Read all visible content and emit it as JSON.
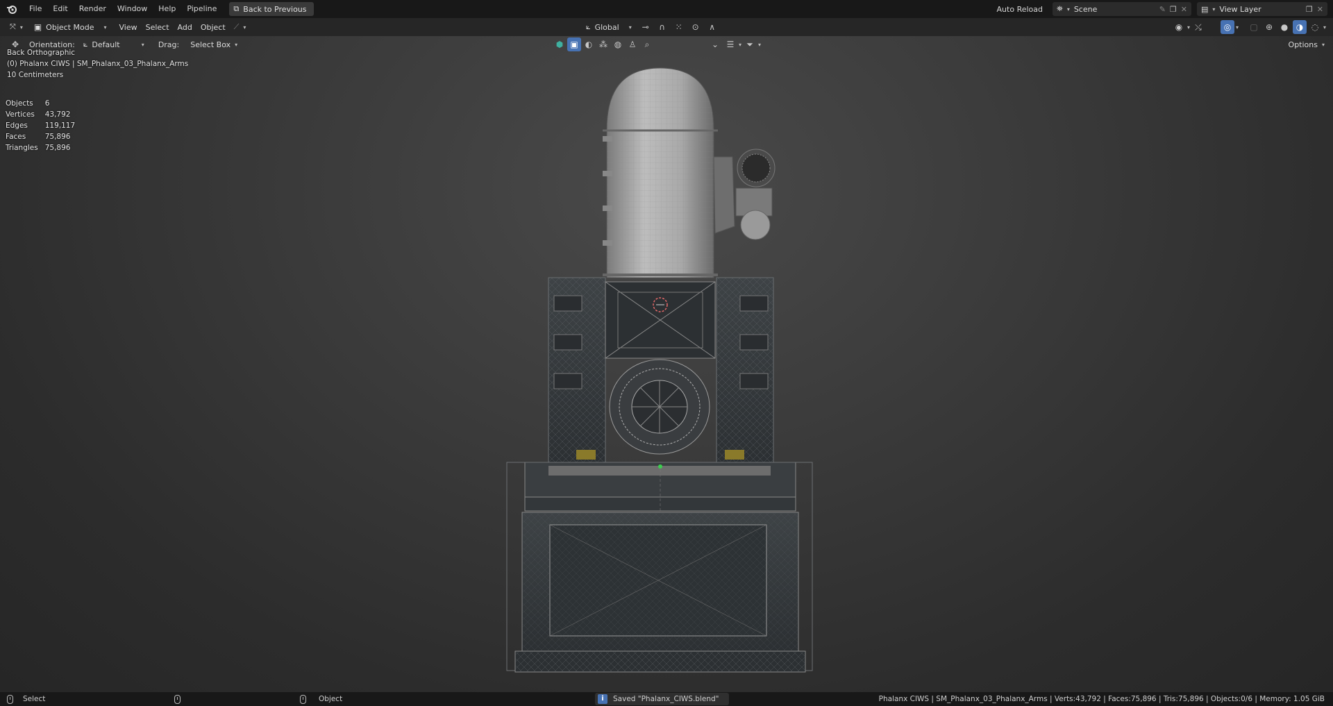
{
  "menu": {
    "items": [
      "File",
      "Edit",
      "Render",
      "Window",
      "Help",
      "Pipeline"
    ],
    "back_button": "Back to Previous"
  },
  "topright": {
    "auto_reload": "Auto Reload",
    "scene": "Scene",
    "view_layer": "View Layer"
  },
  "header": {
    "mode": "Object Mode",
    "menus": [
      "View",
      "Select",
      "Add",
      "Object"
    ],
    "transform_orientation": "Global"
  },
  "tool_settings": {
    "orientation_label": "Orientation:",
    "orientation_value": "Default",
    "drag_label": "Drag:",
    "drag_value": "Select Box",
    "options": "Options"
  },
  "overlay": {
    "view_name": "Back Orthographic",
    "object_path": "(0) Phalanx CIWS | SM_Phalanx_03_Phalanx_Arms",
    "scale": "10 Centimeters",
    "stats": [
      {
        "label": "Objects",
        "value": "6"
      },
      {
        "label": "Vertices",
        "value": "43,792"
      },
      {
        "label": "Edges",
        "value": "119,117"
      },
      {
        "label": "Faces",
        "value": "75,896"
      },
      {
        "label": "Triangles",
        "value": "75,896"
      }
    ]
  },
  "statusbar": {
    "left_action": "Select",
    "mid_action": "Object",
    "saved_message": "Saved \"Phalanx_CIWS.blend\"",
    "right_info": "Phalanx CIWS | SM_Phalanx_03_Phalanx_Arms | Verts:43,792 | Faces:75,896 | Tris:75,896 | Objects:0/6 | Memory: 1.05 GiB"
  },
  "colors": {
    "accent": "#4772b3",
    "background": "#1d1d1d",
    "viewport": "#3c3c3c"
  }
}
